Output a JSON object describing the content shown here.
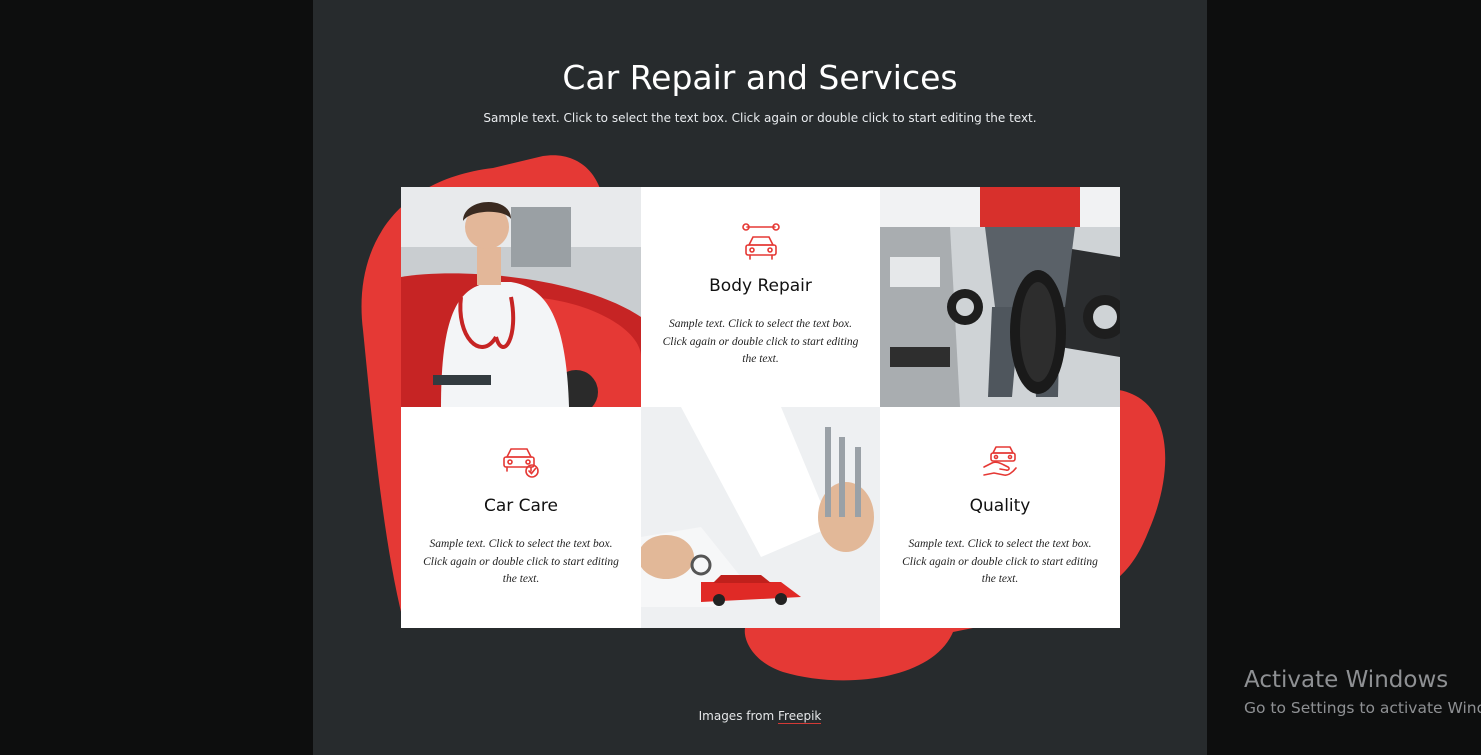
{
  "header": {
    "title": "Car Repair and Services",
    "subtitle": "Sample text. Click to select the text box. Click again or double click to start editing the text."
  },
  "services": [
    {
      "title": "Body Repair",
      "text": "Sample text. Click to select the text box. Click again or double click to start editing the text.",
      "icon": "car-wrench-icon"
    },
    {
      "title": "Car Care",
      "text": "Sample text. Click to select the text box. Click again or double click to start editing the text.",
      "icon": "car-check-icon"
    },
    {
      "title": "Quality",
      "text": "Sample text. Click to select the text box. Click again or double click to start editing the text.",
      "icon": "car-in-hand-icon"
    }
  ],
  "photos": [
    "mechanic-in-white-coat-photo",
    "mechanic-with-tire-photo",
    "wrenches-and-toy-car-photo"
  ],
  "footer": {
    "prefix": "Images from",
    "link_label": "Freepik"
  },
  "os_watermark": {
    "title": "Activate Windows",
    "subtitle": "Go to Settings to activate Windows."
  },
  "colors": {
    "accent": "#e53935",
    "page_background": "#272b2d",
    "outer_background": "#0d0e0e",
    "card_background": "#ffffff"
  }
}
